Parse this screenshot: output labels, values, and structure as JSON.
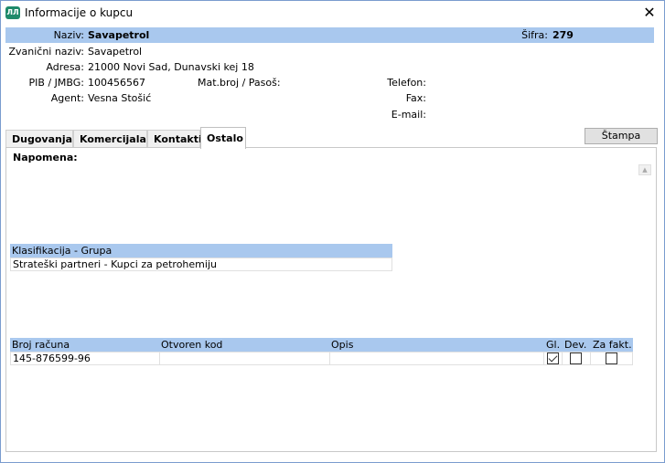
{
  "window": {
    "title": "Informacije o kupcu",
    "close_glyph": "✕"
  },
  "header": {
    "naziv_label": "Naziv:",
    "naziv_value": "Savapetrol",
    "sifra_label": "Šifra:",
    "sifra_value": "279",
    "zvanicni_label": "Zvanični naziv:",
    "zvanicni_value": "Savapetrol",
    "adresa_label": "Adresa:",
    "adresa_value": "21000 Novi Sad, Dunavski kej 18",
    "pib_label": "PIB / JMBG:",
    "pib_value": "100456567",
    "matbroj_label": "Mat.broj / Pasoš:",
    "matbroj_value": "",
    "agent_label": "Agent:",
    "agent_value": "Vesna Stošić",
    "telefon_label": "Telefon:",
    "telefon_value": "",
    "fax_label": "Fax:",
    "fax_value": "",
    "email_label": "E-mail:",
    "email_value": ""
  },
  "tabs": [
    "Dugovanja",
    "Komercijala",
    "Kontakti",
    "Ostalo"
  ],
  "active_tab": "Ostalo",
  "print_button": "Štampa",
  "panel": {
    "napomena_label": "Napomena:",
    "klasifikacija": {
      "header": "Klasifikacija - Grupa",
      "rows": [
        "Strateški partneri - Kupci za petrohemiju"
      ]
    },
    "accounts": {
      "columns": [
        "Broj računa",
        "Otvoren kod",
        "Opis",
        "Gl.",
        "Dev.",
        "Za fakt."
      ],
      "rows": [
        {
          "broj": "145-876599-96",
          "otvoren": "",
          "opis": "",
          "gl": true,
          "dev": false,
          "zafakt": false
        }
      ]
    }
  },
  "colors": {
    "highlight": "#a9c8ee",
    "app_icon": "#1f8a6a"
  }
}
